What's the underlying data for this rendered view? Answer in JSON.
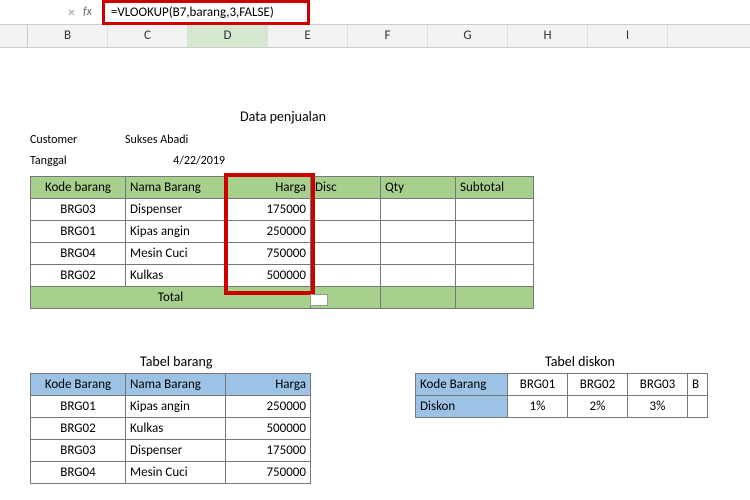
{
  "formula_bar": {
    "sep": "×",
    "fx_label": "fx",
    "formula": "=VLOOKUP(B7,barang,3,FALSE)"
  },
  "columns": [
    "B",
    "C",
    "D",
    "E",
    "F",
    "G",
    "H",
    "I"
  ],
  "active_col": "D",
  "penjualan": {
    "title": "Data penjualan",
    "customer_label": "Customer",
    "customer_value": "Sukses Abadi",
    "tanggal_label": "Tanggal",
    "tanggal_value": "4/22/2019",
    "headers": {
      "kode": "Kode barang",
      "nama": "Nama Barang",
      "harga": "Harga",
      "disc": "Disc",
      "qty": "Qty",
      "sub": "Subtotal"
    },
    "rows": [
      {
        "kode": "BRG03",
        "nama": "Dispenser",
        "harga": "175000"
      },
      {
        "kode": "BRG01",
        "nama": "Kipas angin",
        "harga": "250000"
      },
      {
        "kode": "BRG04",
        "nama": "Mesin Cuci",
        "harga": "750000"
      },
      {
        "kode": "BRG02",
        "nama": "Kulkas",
        "harga": "500000"
      }
    ],
    "total_label": "Total"
  },
  "barang": {
    "title": "Tabel barang",
    "headers": {
      "kode": "Kode Barang",
      "nama": "Nama Barang",
      "harga": "Harga"
    },
    "rows": [
      {
        "kode": "BRG01",
        "nama": "Kipas angin",
        "harga": "250000"
      },
      {
        "kode": "BRG02",
        "nama": "Kulkas",
        "harga": "500000"
      },
      {
        "kode": "BRG03",
        "nama": "Dispenser",
        "harga": "175000"
      },
      {
        "kode": "BRG04",
        "nama": "Mesin Cuci",
        "harga": "750000"
      }
    ]
  },
  "diskon": {
    "title": "Tabel diskon",
    "kode_label": "Kode Barang",
    "diskon_label": "Diskon",
    "cols": [
      "BRG01",
      "BRG02",
      "BRG03"
    ],
    "last_col_partial": "B",
    "values": [
      "1%",
      "2%",
      "3%"
    ]
  }
}
